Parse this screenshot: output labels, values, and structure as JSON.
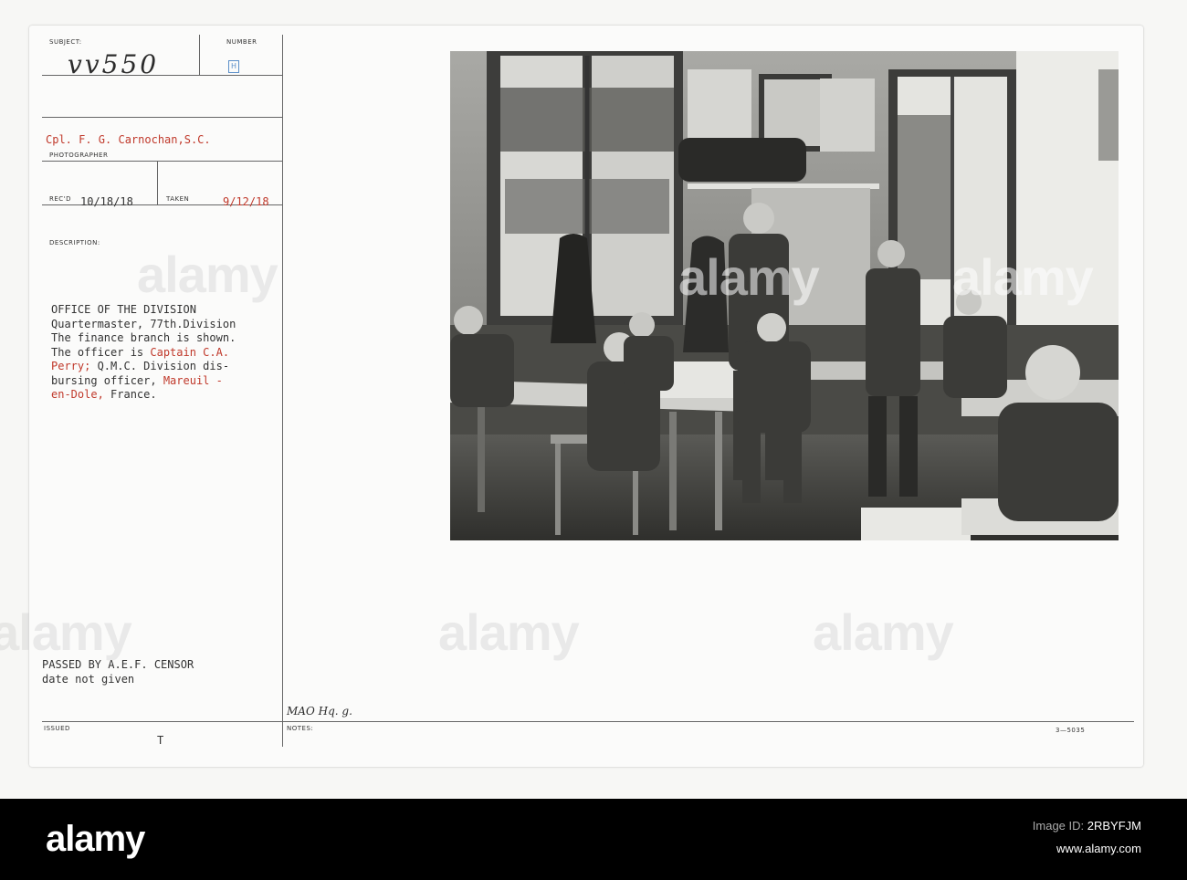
{
  "labels": {
    "subject": "SUBJECT:",
    "number": "NUMBER",
    "photographer": "PHOTOGRAPHER",
    "recd": "REC'D",
    "taken": "TAKEN",
    "description": "DESCRIPTION:",
    "issued": "ISSUED",
    "notes": "NOTES:"
  },
  "record": {
    "subject_no": "vv550",
    "number_stamp": "H",
    "photographer": "Cpl. F. G. Carnochan,S.C.",
    "recd_date": "10/18/18",
    "taken_date": "9/12/18",
    "issued_mark": "T",
    "notes_handwritten": "MAO Hq. g.",
    "form_code": "3—5035"
  },
  "description_lines": [
    {
      "text": "OFFICE OF THE DIVISION",
      "red": ""
    },
    {
      "text": "Quartermaster, 77th.Division",
      "red": ""
    },
    {
      "text": "The finance branch is shown.",
      "red": ""
    },
    {
      "text": "The officer is ",
      "red": "Captain C.A."
    },
    {
      "text": "",
      "red": "Perry;",
      "after": " Q.M.C. Division dis-"
    },
    {
      "text": "bursing officer, ",
      "red": "Mareuil -"
    },
    {
      "text": "",
      "red": "en-Dole,",
      "after": " France."
    }
  ],
  "censor": {
    "line1": "PASSED BY A.E.F. CENSOR",
    "line2": "date not given"
  },
  "watermark": "alamy",
  "footer": {
    "logo": "alamy",
    "image_id_label": "Image ID:",
    "image_id": "2RBYFJM",
    "site": "www.alamy.com"
  },
  "colors": {
    "red_ink": "#c0392b",
    "stamp_blue": "#5b8fc9",
    "footer_bg": "#000000"
  }
}
